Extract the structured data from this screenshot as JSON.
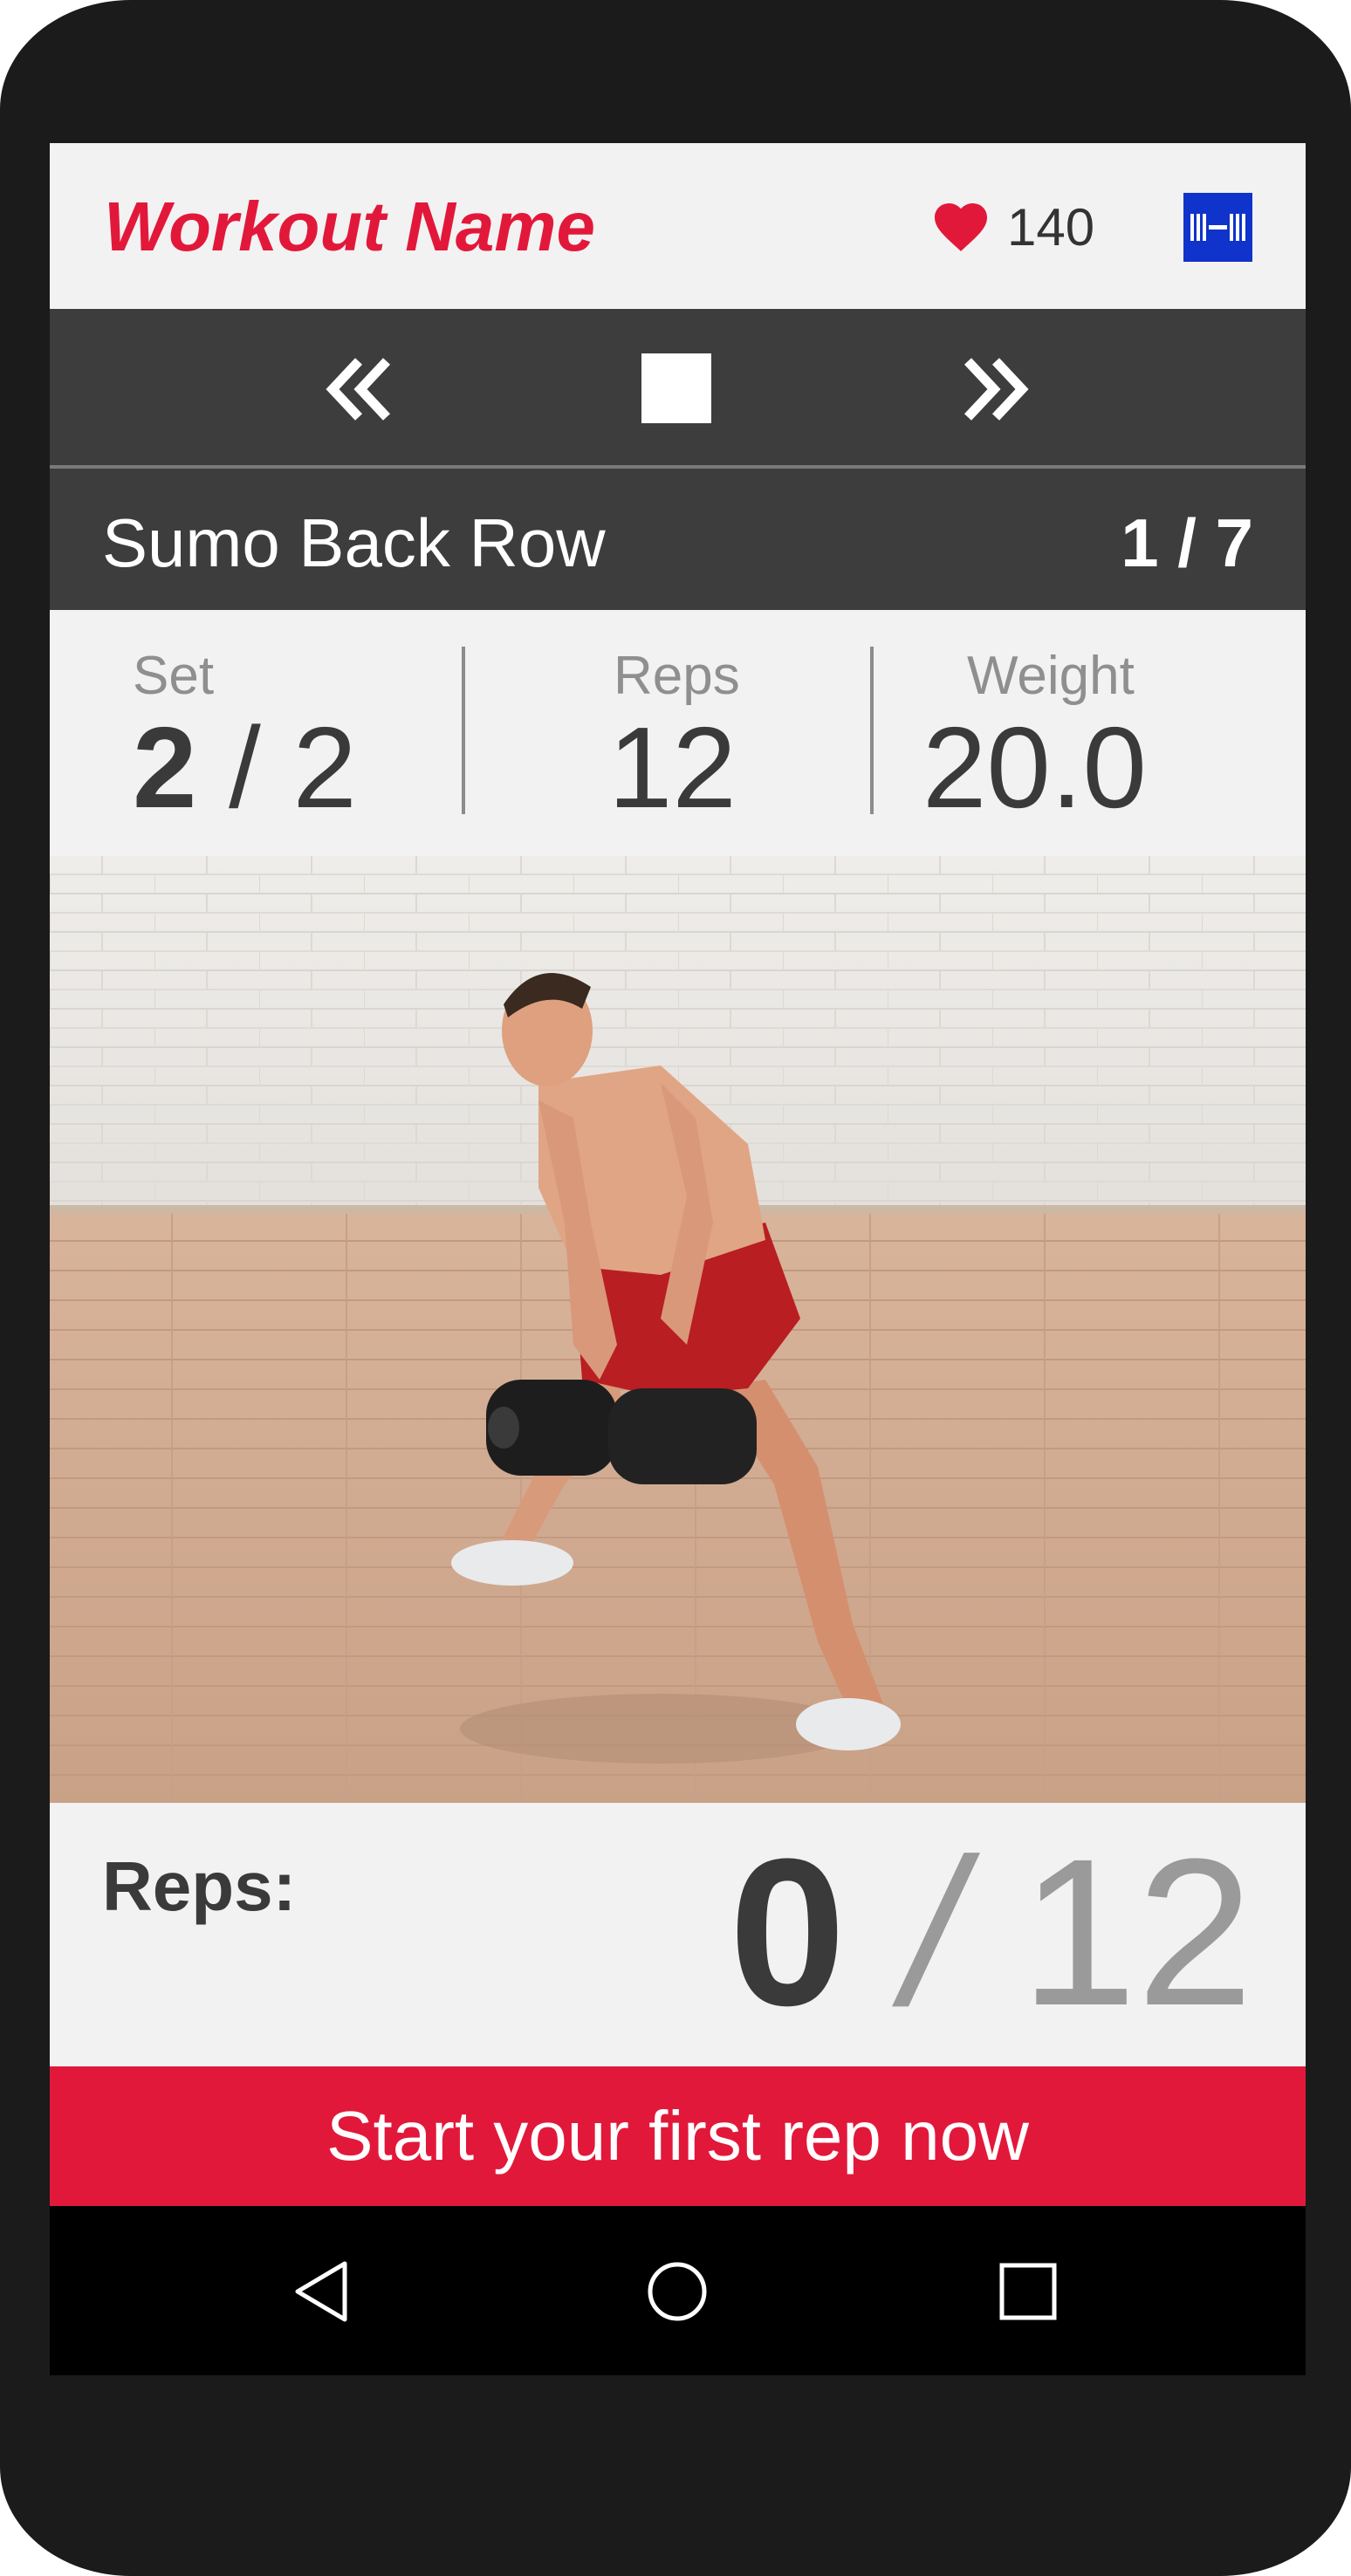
{
  "header": {
    "workout_name": "Workout Name",
    "heart_rate": "140",
    "heart_icon": "heart-icon",
    "device_icon": "barbell-device-icon"
  },
  "controls": {
    "previous_icon": "double-chevron-left-icon",
    "stop_icon": "stop-icon",
    "next_icon": "double-chevron-right-icon"
  },
  "exercise": {
    "name": "Sumo Back Row",
    "progress": "1 / 7"
  },
  "stats": {
    "set": {
      "label": "Set",
      "current": "2",
      "separator": " / ",
      "total": "2"
    },
    "reps": {
      "label": "Reps",
      "value": "12"
    },
    "weight": {
      "label": "Weight",
      "value": "20.0"
    }
  },
  "reps_counter": {
    "label": "Reps:",
    "current": "0",
    "separator": " / ",
    "total": "12"
  },
  "cta": {
    "label": "Start your first rep now"
  },
  "navbar": {
    "back_icon": "back-triangle-icon",
    "home_icon": "home-circle-icon",
    "recents_icon": "recents-square-icon"
  },
  "colors": {
    "accent": "#e2183b",
    "dark_bar": "#3d3d3d",
    "panel": "#f2f2f2",
    "device_blue": "#1033cc",
    "phone_body": "#1b1b1b"
  }
}
